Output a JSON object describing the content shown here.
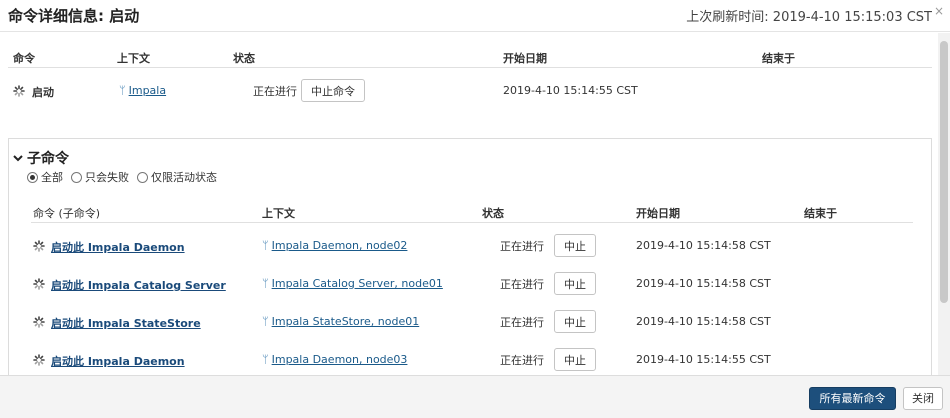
{
  "header": {
    "title": "命令详细信息: 启动",
    "refresh": "上次刷新时间: 2019-4-10 15:15:03 CST",
    "close_glyph": "×"
  },
  "main_table": {
    "headers": [
      "命令",
      "上下文",
      "状态",
      "开始日期",
      "结束于"
    ],
    "row": {
      "command": "启动",
      "context": "Impala",
      "status": "正在进行",
      "abort_label": "中止命令",
      "start": "2019-4-10 15:14:55 CST",
      "end": ""
    }
  },
  "sub_commands": {
    "title": "子命令",
    "filters": [
      {
        "label": "全部",
        "checked": true
      },
      {
        "label": "只会失败",
        "checked": false
      },
      {
        "label": "仅限活动状态",
        "checked": false
      }
    ],
    "headers": [
      "命令 (子命令)",
      "上下文",
      "状态",
      "开始日期",
      "结束于"
    ],
    "rows": [
      {
        "command": "启动此 Impala Daemon",
        "context": "Impala Daemon, node02",
        "status": "正在进行",
        "abort_label": "中止",
        "start": "2019-4-10 15:14:58 CST",
        "end": ""
      },
      {
        "command": "启动此 Impala Catalog Server",
        "context": "Impala Catalog Server, node01",
        "status": "正在进行",
        "abort_label": "中止",
        "start": "2019-4-10 15:14:58 CST",
        "end": ""
      },
      {
        "command": "启动此 Impala StateStore",
        "context": "Impala StateStore, node01",
        "status": "正在进行",
        "abort_label": "中止",
        "start": "2019-4-10 15:14:58 CST",
        "end": ""
      },
      {
        "command": "启动此 Impala Daemon",
        "context": "Impala Daemon, node03",
        "status": "正在进行",
        "abort_label": "中止",
        "start": "2019-4-10 15:14:55 CST",
        "end": ""
      }
    ]
  },
  "footer": {
    "recent_label": "所有最新命令",
    "close_label": "关闭"
  },
  "colors": {
    "primary": "#1d4f7c",
    "link": "#1a5a8a"
  }
}
